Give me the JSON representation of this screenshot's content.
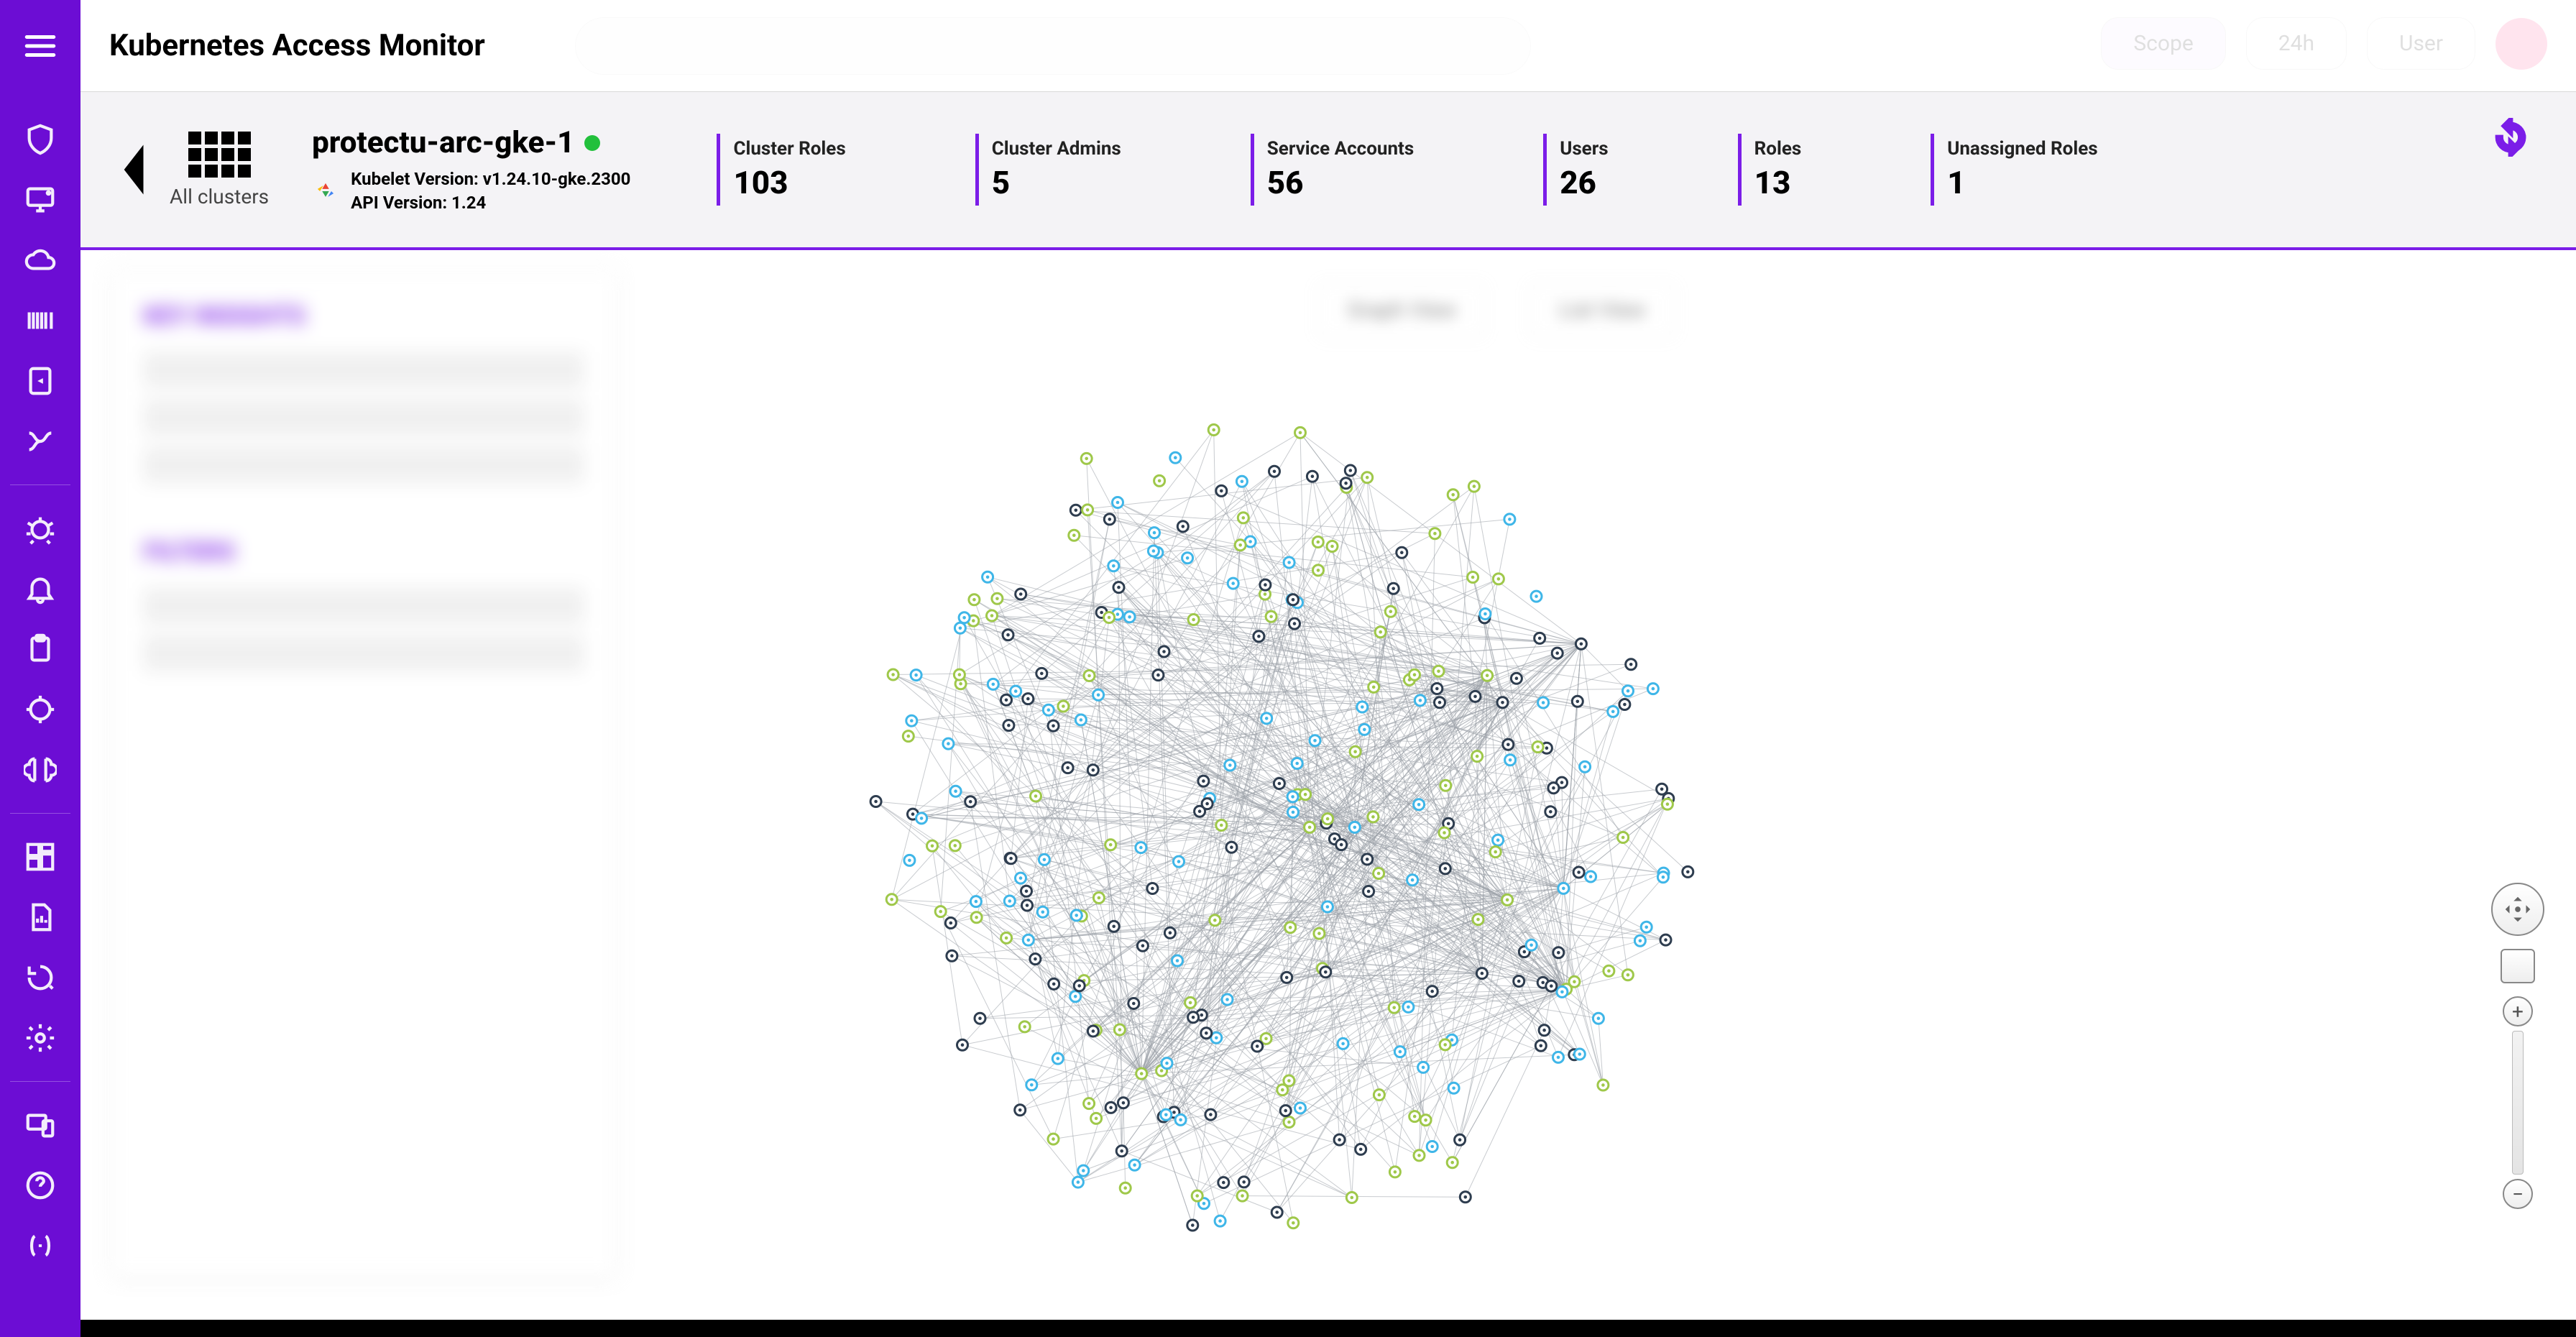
{
  "app": {
    "title": "Kubernetes Access Monitor"
  },
  "cluster": {
    "name": "protectu-arc-gke-1",
    "kubelet_label": "Kubelet Version: v1.24.10-gke.2300",
    "api_label": "API Version: 1.24",
    "all_clusters_label": "All clusters"
  },
  "metrics": [
    {
      "title": "Cluster Roles",
      "value": "103"
    },
    {
      "title": "Cluster Admins",
      "value": "5"
    },
    {
      "title": "Service Accounts",
      "value": "56"
    },
    {
      "title": "Users",
      "value": "26"
    },
    {
      "title": "Roles",
      "value": "13"
    },
    {
      "title": "Unassigned Roles",
      "value": "1"
    }
  ],
  "sidebar_panel": {
    "header": "KEY INSIGHTS",
    "header2": "FILTERS"
  },
  "viewbar": {
    "graph_label": "Graph View",
    "list_label": "List View"
  },
  "graph": {
    "nodes": 310,
    "edges": 720,
    "seed": 3271,
    "palette": {
      "a": "#3fb6e8",
      "b": "#9fc84a",
      "c": "#2e3d4f"
    }
  }
}
